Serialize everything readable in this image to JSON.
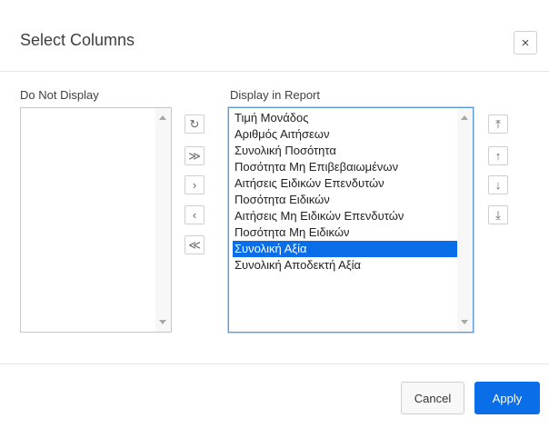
{
  "dialog": {
    "title": "Select Columns",
    "close_glyph": "×"
  },
  "left_list": {
    "label": "Do Not Display",
    "items": []
  },
  "right_list": {
    "label": "Display in Report",
    "items": [
      "Τιμή Μονάδος",
      "Αριθμός Αιτήσεων",
      "Συνολική Ποσότητα",
      "Ποσότητα Μη Επιβεβαιωμένων",
      "Αιτήσεις Ειδικών Επενδυτών",
      "Ποσότητα Ειδικών",
      "Αιτήσεις Μη Ειδικών Επενδυτών",
      "Ποσότητα Μη Ειδικών",
      "Συνολική Αξία",
      "Συνολική Αποδεκτή Αξία"
    ],
    "selected_index": 8
  },
  "move_buttons": {
    "reset": "↻",
    "move_all_right": "≫",
    "move_right": "›",
    "move_left": "‹",
    "move_all_left": "≪"
  },
  "order_buttons": {
    "top": "⤒",
    "up": "↑",
    "down": "↓",
    "bottom": "⤓"
  },
  "footer": {
    "cancel_label": "Cancel",
    "apply_label": "Apply"
  },
  "colors": {
    "accent": "#0a6ee8"
  }
}
